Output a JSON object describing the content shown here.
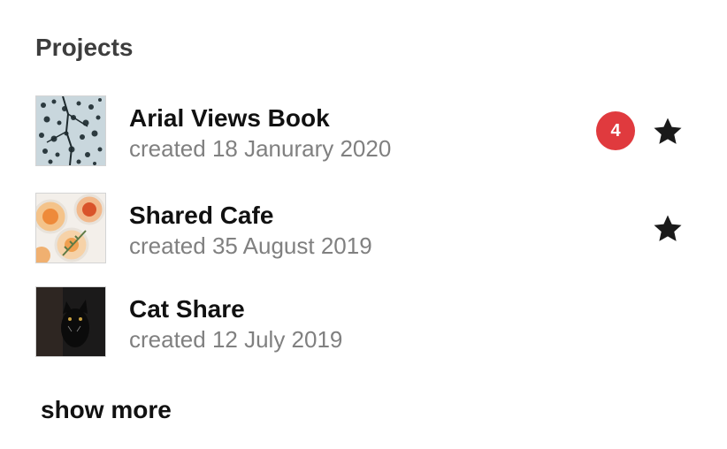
{
  "section": {
    "title": "Projects"
  },
  "projects": [
    {
      "name": "Arial Views Book",
      "created": "created 18 Janurary 2020",
      "notification_count": "4",
      "starred": true,
      "thumbnail": "snowy-forest-aerial"
    },
    {
      "name": "Shared Cafe",
      "created": "created 35 August 2019",
      "starred": true,
      "thumbnail": "drinks-on-table"
    },
    {
      "name": "Cat Share",
      "created": "created 12 July 2019",
      "starred": false,
      "thumbnail": "black-cat"
    }
  ],
  "show_more_label": "show more",
  "colors": {
    "badge": "#e03a3e",
    "star": "#1a1a1a",
    "title": "#3d3d3d",
    "date": "#808080"
  }
}
